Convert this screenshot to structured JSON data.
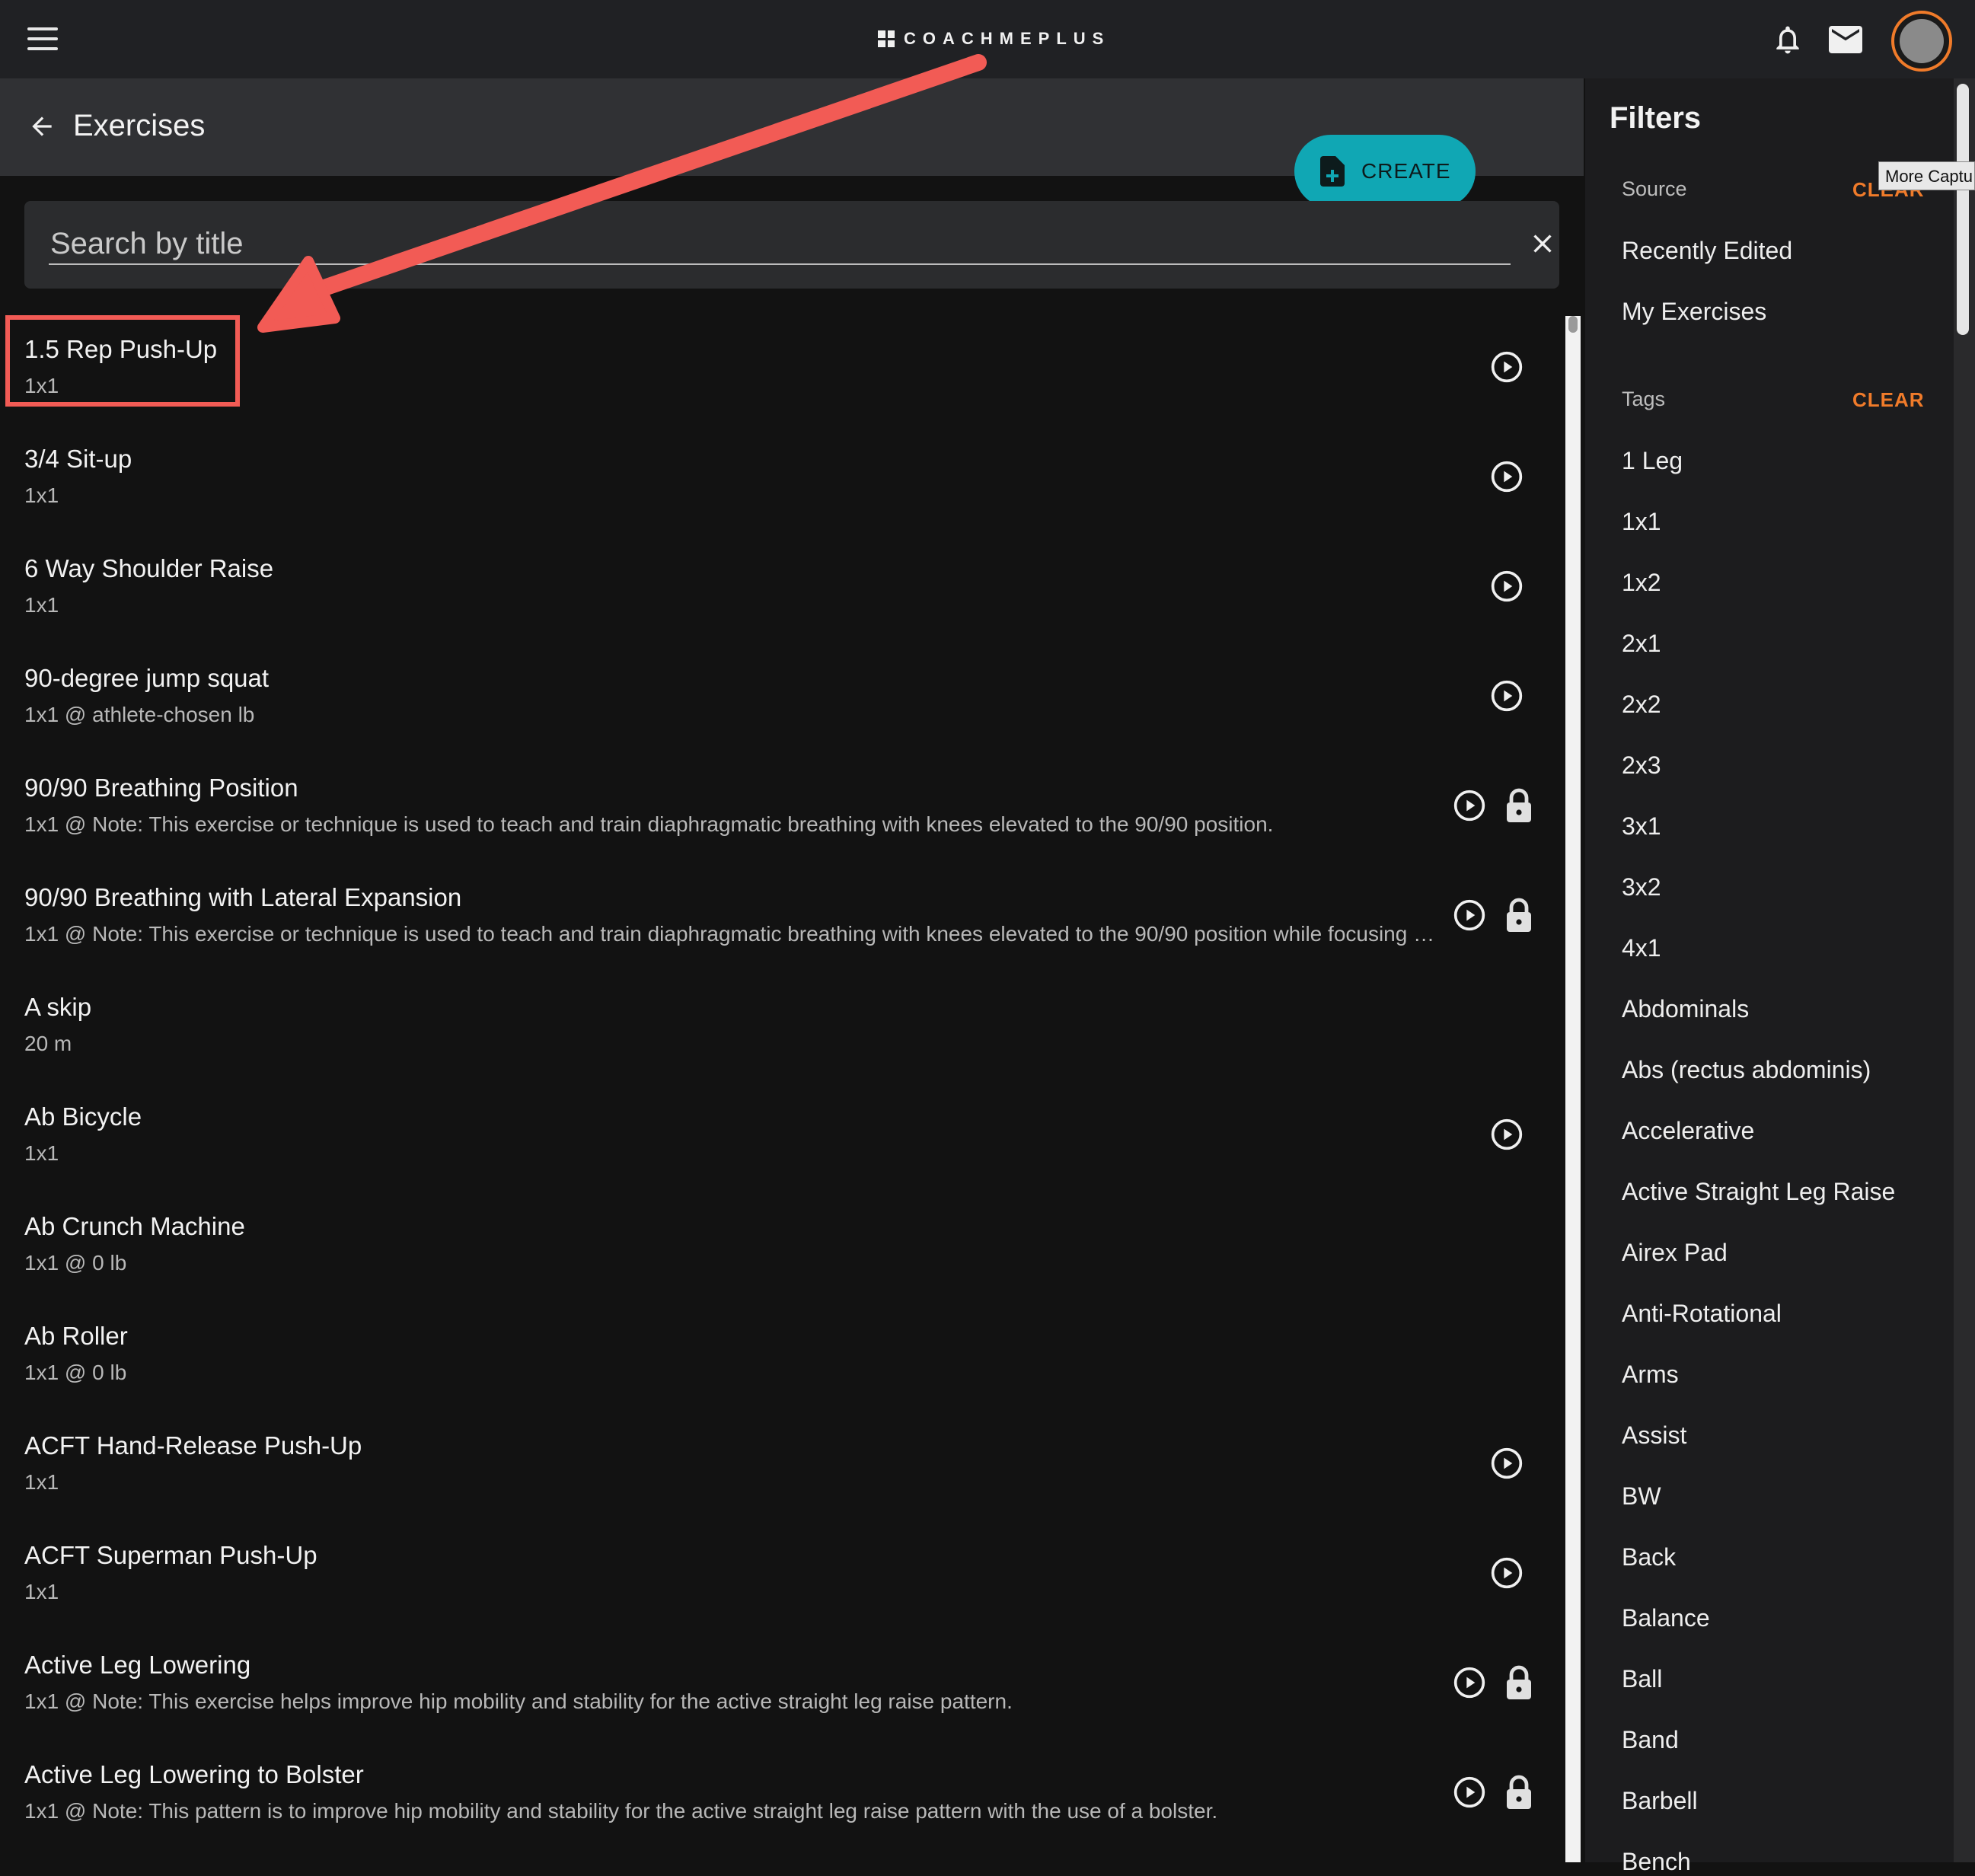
{
  "app": {
    "logo_text": "COACHMEPLUS"
  },
  "topbar": {
    "menu_icon": "menu-icon",
    "bell_icon": "bell-icon",
    "mail_icon": "mail-icon",
    "avatar": "user-avatar"
  },
  "header": {
    "title": "Exercises",
    "create_label": "CREATE"
  },
  "search": {
    "placeholder": "Search by title"
  },
  "exercises": [
    {
      "title": "1.5 Rep Push-Up",
      "sub": "1x1",
      "video": true,
      "locked": false
    },
    {
      "title": "3/4 Sit-up",
      "sub": "1x1",
      "video": true,
      "locked": false
    },
    {
      "title": "6 Way Shoulder Raise",
      "sub": "1x1",
      "video": true,
      "locked": false
    },
    {
      "title": "90-degree jump squat",
      "sub": "1x1 @ athlete-chosen lb",
      "video": true,
      "locked": false
    },
    {
      "title": "90/90 Breathing Position",
      "sub": "1x1 @ Note: This exercise or technique is used to teach and train diaphragmatic breathing with knees elevated to the 90/90 position.",
      "video": true,
      "locked": true
    },
    {
      "title": "90/90 Breathing with Lateral Expansion",
      "sub": "1x1 @ Note: This exercise or technique is used to teach and train diaphragmatic breathing with knees elevated to the 90/90 position while focusing o…",
      "video": true,
      "locked": true
    },
    {
      "title": "A skip",
      "sub": "20 m",
      "video": false,
      "locked": false
    },
    {
      "title": "Ab Bicycle",
      "sub": "1x1",
      "video": true,
      "locked": false
    },
    {
      "title": "Ab Crunch Machine",
      "sub": "1x1 @ 0 lb",
      "video": false,
      "locked": false
    },
    {
      "title": "Ab Roller",
      "sub": "1x1 @ 0 lb",
      "video": false,
      "locked": false
    },
    {
      "title": "ACFT Hand-Release Push-Up",
      "sub": "1x1",
      "video": true,
      "locked": false
    },
    {
      "title": "ACFT Superman Push-Up",
      "sub": "1x1",
      "video": true,
      "locked": false
    },
    {
      "title": "Active Leg Lowering",
      "sub": "1x1 @ Note: This exercise helps improve hip mobility and stability for the active straight leg raise pattern.",
      "video": true,
      "locked": true
    },
    {
      "title": "Active Leg Lowering to Bolster",
      "sub": "1x1 @ Note: This pattern is to improve hip mobility and stability for the active straight leg raise pattern with the use of a bolster.",
      "video": true,
      "locked": true
    }
  ],
  "filters": {
    "title": "Filters",
    "source": {
      "label": "Source",
      "clear": "CLEAR",
      "items": [
        "Recently Edited",
        "My Exercises"
      ]
    },
    "tags": {
      "label": "Tags",
      "clear": "CLEAR",
      "items": [
        "1 Leg",
        "1x1",
        "1x2",
        "2x1",
        "2x2",
        "2x3",
        "3x1",
        "3x2",
        "4x1",
        "Abdominals",
        "Abs (rectus abdominis)",
        "Accelerative",
        "Active Straight Leg Raise",
        "Airex Pad",
        "Anti-Rotational",
        "Arms",
        "Assist",
        "BW",
        "Back",
        "Balance",
        "Ball",
        "Band",
        "Barbell",
        "Bench"
      ]
    }
  },
  "tooltip": "More Captu",
  "colors": {
    "accent_teal": "#10a7b4",
    "accent_orange": "#f07b2a",
    "annotation_red": "#f25b55"
  }
}
